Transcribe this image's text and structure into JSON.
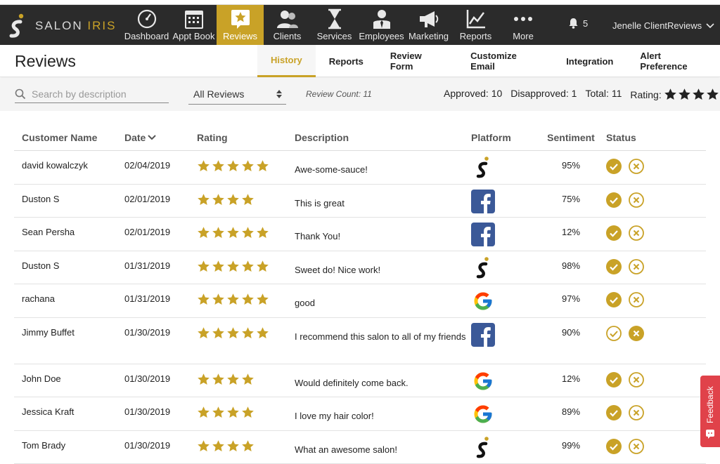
{
  "app": {
    "logo_text_main": "SALON",
    "logo_text_accent": "IRIS"
  },
  "nav": {
    "items": [
      {
        "label": "Dashboard",
        "icon": "gauge-icon",
        "active": false
      },
      {
        "label": "Appt Book",
        "icon": "calendar-icon",
        "active": false
      },
      {
        "label": "Reviews",
        "icon": "star-badge-icon",
        "active": true
      },
      {
        "label": "Clients",
        "icon": "clients-icon",
        "active": false
      },
      {
        "label": "Services",
        "icon": "hourglass-icon",
        "active": false
      },
      {
        "label": "Employees",
        "icon": "employee-icon",
        "active": false
      },
      {
        "label": "Marketing",
        "icon": "megaphone-icon",
        "active": false
      },
      {
        "label": "Reports",
        "icon": "line-chart-icon",
        "active": false
      },
      {
        "label": "More",
        "icon": "more-dots-icon",
        "active": false
      }
    ],
    "notification_count": "5",
    "user_name": "Jenelle ClientReviews"
  },
  "page": {
    "title": "Reviews",
    "tabs": [
      {
        "label": "History",
        "active": true
      },
      {
        "label": "Reports",
        "active": false
      },
      {
        "label": "Review Form",
        "active": false
      },
      {
        "label": "Customize Email",
        "active": false
      },
      {
        "label": "Integration",
        "active": false
      },
      {
        "label": "Alert Preference",
        "active": false
      }
    ]
  },
  "filters": {
    "search_placeholder": "Search by description",
    "filter_value": "All Reviews",
    "review_count": "Review Count: 11",
    "approved": "Approved: 10",
    "disapproved": "Disapproved: 1",
    "total": "Total: 11",
    "rating_label": "Rating:",
    "rating_stars": 4
  },
  "table": {
    "headers": {
      "name": "Customer Name",
      "date": "Date",
      "rating": "Rating",
      "description": "Description",
      "platform": "Platform",
      "sentiment": "Sentiment",
      "status": "Status"
    },
    "rows": [
      {
        "name": "david kowalczyk",
        "date": "02/04/2019",
        "stars": 5,
        "description": "Awe-some-sauce!",
        "platform": "salon-iris",
        "sentiment": "95%",
        "approved": true
      },
      {
        "name": "Duston S",
        "date": "02/01/2019",
        "stars": 4,
        "description": "This is great",
        "platform": "facebook",
        "sentiment": "75%",
        "approved": true
      },
      {
        "name": "Sean Persha",
        "date": "02/01/2019",
        "stars": 5,
        "description": "Thank You!",
        "platform": "facebook",
        "sentiment": "12%",
        "approved": true
      },
      {
        "name": "Duston S",
        "date": "01/31/2019",
        "stars": 5,
        "description": "Sweet do! Nice work!",
        "platform": "salon-iris",
        "sentiment": "98%",
        "approved": true
      },
      {
        "name": "rachana",
        "date": "01/31/2019",
        "stars": 5,
        "description": "good",
        "platform": "google",
        "sentiment": "97%",
        "approved": true
      },
      {
        "name": "Jimmy Buffet",
        "date": "01/30/2019",
        "stars": 5,
        "description": "I recommend this salon to all of my friends",
        "platform": "facebook",
        "sentiment": "90%",
        "approved": false
      },
      {
        "name": "John Doe",
        "date": "01/30/2019",
        "stars": 4,
        "description": "Would definitely come back.",
        "platform": "google",
        "sentiment": "12%",
        "approved": true
      },
      {
        "name": "Jessica Kraft",
        "date": "01/30/2019",
        "stars": 4,
        "description": "I love my hair color!",
        "platform": "google",
        "sentiment": "89%",
        "approved": true
      },
      {
        "name": "Tom Brady",
        "date": "01/30/2019",
        "stars": 4,
        "description": "What an awesome salon!",
        "platform": "salon-iris",
        "sentiment": "99%",
        "approved": true
      }
    ]
  },
  "feedback_label": "Feedback",
  "colors": {
    "accent": "#c9a227",
    "nav_bg": "#2b2b2b",
    "facebook": "#3b5998",
    "feedback": "#e0424a"
  }
}
